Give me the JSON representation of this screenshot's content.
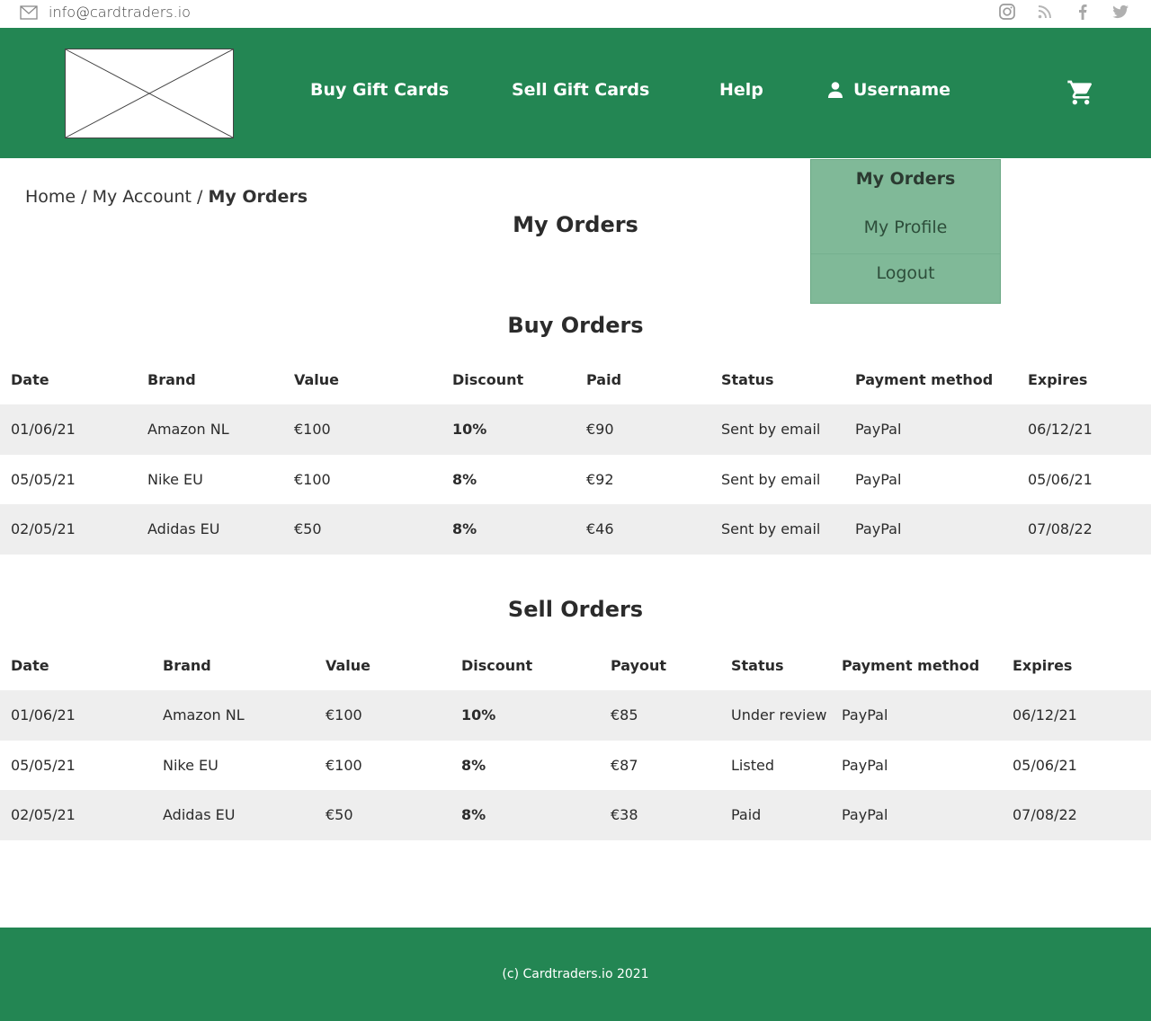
{
  "topbar": {
    "email": "info@cardtraders.io",
    "social_icons": [
      "instagram-icon",
      "rss-icon",
      "facebook-icon",
      "twitter-icon"
    ]
  },
  "header": {
    "nav": {
      "buy": "Buy Gift Cards",
      "sell": "Sell Gift Cards",
      "help": "Help",
      "username": "Username"
    }
  },
  "dropdown": {
    "items": [
      "My Orders",
      "My Profile",
      "Logout"
    ]
  },
  "breadcrumb": {
    "home": "Home",
    "account": "My Account",
    "current": "My Orders",
    "separator": " / "
  },
  "page_title": "My Orders",
  "buy_orders": {
    "title": "Buy Orders",
    "columns": [
      "Date",
      "Brand",
      "Value",
      "Discount",
      "Paid",
      "Status",
      "Payment method",
      "Expires"
    ],
    "rows": [
      [
        "01/06/21",
        "Amazon NL",
        "€100",
        "10%",
        "€90",
        "Sent by email",
        "PayPal",
        "06/12/21"
      ],
      [
        "05/05/21",
        "Nike EU",
        "€100",
        "8%",
        "€92",
        "Sent by email",
        "PayPal",
        "05/06/21"
      ],
      [
        "02/05/21",
        "Adidas EU",
        "€50",
        "8%",
        "€46",
        "Sent by email",
        "PayPal",
        "07/08/22"
      ]
    ]
  },
  "sell_orders": {
    "title": "Sell Orders",
    "columns": [
      "Date",
      "Brand",
      "Value",
      "Discount",
      "Payout",
      "Status",
      "Payment method",
      "Expires"
    ],
    "rows": [
      [
        "01/06/21",
        "Amazon NL",
        "€100",
        "10%",
        "€85",
        "Under review",
        "PayPal",
        "06/12/21"
      ],
      [
        "05/05/21",
        "Nike EU",
        "€100",
        "8%",
        "€87",
        "Listed",
        "PayPal",
        "05/06/21"
      ],
      [
        "02/05/21",
        "Adidas EU",
        "€50",
        "8%",
        "€38",
        "Paid",
        "PayPal",
        "07/08/22"
      ]
    ]
  },
  "footer": {
    "text": "(c) Cardtraders.io 2021"
  },
  "colors": {
    "brand_green": "#238653",
    "dropdown_green": "#80b998",
    "row_shade": "#eeeeee"
  }
}
